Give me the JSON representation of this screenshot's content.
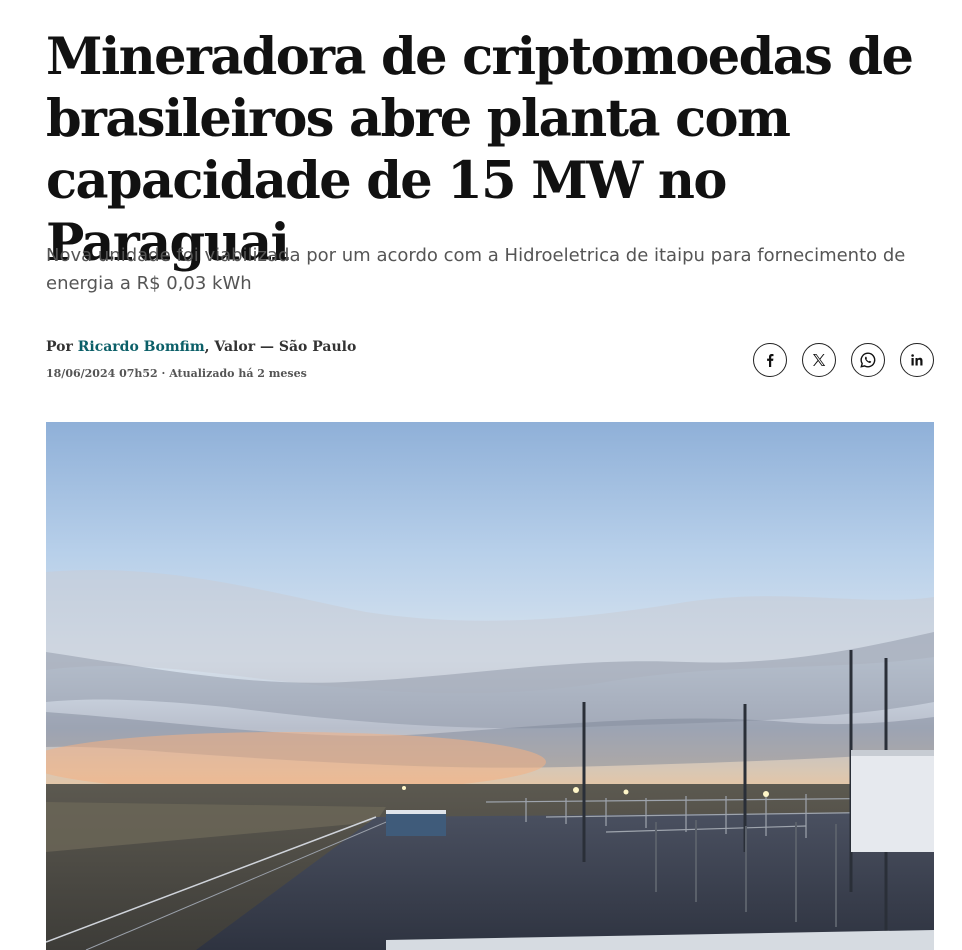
{
  "article": {
    "headline": "Mineradora de criptomoedas de brasileiros abre planta com capacidade de 15 MW no Paraguai",
    "subtitle": "Nova unidade foi viabilizada por um acordo com a Hidroeletrica de itaipu para fornecimento de energia a R$ 0,03 kWh",
    "byline": {
      "prefix": "Por ",
      "author": "Ricardo Bomfim",
      "outlet": ", Valor — São Paulo"
    },
    "dateline": "18/06/2024 07h52 · Atualizado há 2 meses"
  },
  "share": {
    "buttons": [
      {
        "icon": "facebook-icon"
      },
      {
        "icon": "x-icon"
      },
      {
        "icon": "whatsapp-icon"
      },
      {
        "icon": "linkedin-icon"
      }
    ]
  },
  "hero_image": {
    "description_icon": "photo"
  },
  "colors": {
    "author_link": "#0b5f68",
    "subtitle": "#555555"
  }
}
